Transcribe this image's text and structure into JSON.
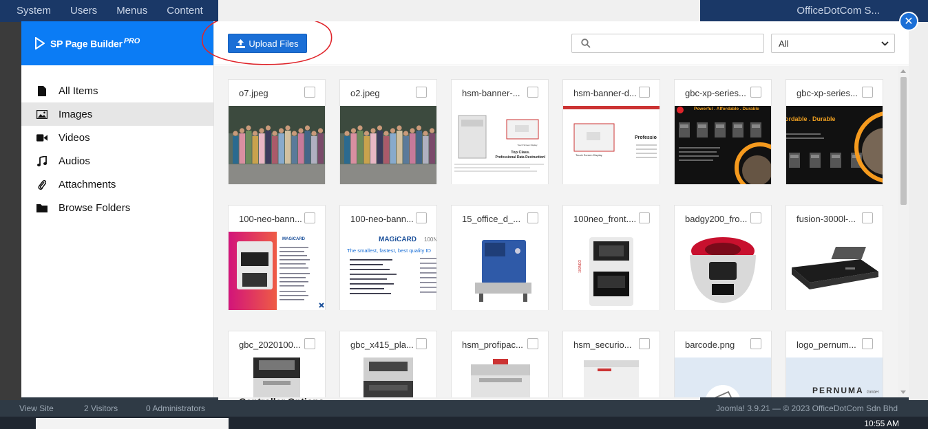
{
  "background": {
    "menu": [
      "System",
      "Users",
      "Menus",
      "Content"
    ],
    "site_name": "OfficeDotCom S...",
    "status_items": [
      "View Site",
      "2 Visitors",
      "0 Administrators"
    ],
    "footer": "Joomla! 3.9.21 — © 2023 OfficeDotCom Sdn Bhd",
    "controller_options": "Controller Options",
    "clock": "10:55 AM"
  },
  "sidebar": {
    "brand": "SP Page Builder",
    "brand_suffix": "PRO",
    "items": [
      {
        "label": "All Items",
        "icon": "file-icon",
        "active": false
      },
      {
        "label": "Images",
        "icon": "image-icon",
        "active": true
      },
      {
        "label": "Videos",
        "icon": "video-icon",
        "active": false
      },
      {
        "label": "Audios",
        "icon": "music-icon",
        "active": false
      },
      {
        "label": "Attachments",
        "icon": "paperclip-icon",
        "active": false
      },
      {
        "label": "Browse Folders",
        "icon": "folder-icon",
        "active": false
      }
    ]
  },
  "toolbar": {
    "upload_label": "Upload Files",
    "search_placeholder": "",
    "filter_value": "All"
  },
  "files": [
    {
      "name": "o7.jpeg",
      "thumb": "group-photo"
    },
    {
      "name": "o2.jpeg",
      "thumb": "group-photo"
    },
    {
      "name": "hsm-banner-...",
      "thumb": "hsm-banner"
    },
    {
      "name": "hsm-banner-d...",
      "thumb": "hsm-banner-2"
    },
    {
      "name": "gbc-xp-series...",
      "thumb": "gbc-dark"
    },
    {
      "name": "gbc-xp-series...",
      "thumb": "gbc-dark-2"
    },
    {
      "name": "100-neo-bann...",
      "thumb": "magicard-pink"
    },
    {
      "name": "100-neo-bann...",
      "thumb": "magicard-white"
    },
    {
      "name": "15_office_d_...",
      "thumb": "blue-machine"
    },
    {
      "name": "100neo_front....",
      "thumb": "card-printer"
    },
    {
      "name": "badgy200_fro...",
      "thumb": "badgy-printer"
    },
    {
      "name": "fusion-3000l-...",
      "thumb": "laminator"
    },
    {
      "name": "gbc_2020100...",
      "thumb": "shredder-gbc"
    },
    {
      "name": "gbc_x415_pla...",
      "thumb": "shredder-gbc-2"
    },
    {
      "name": "hsm_profipac...",
      "thumb": "hsm-profipack"
    },
    {
      "name": "hsm_securio...",
      "thumb": "hsm-securio"
    },
    {
      "name": "barcode.png",
      "thumb": "barcode"
    },
    {
      "name": "logo_pernum...",
      "thumb": "pernuma-logo"
    }
  ],
  "thumb_text": {
    "top_class": "Top Class.",
    "destruction": "Professional Data Destruction!",
    "touch_screen": "Touch Screen Display",
    "powerful": "Powerful . Affordable . Durable",
    "affordable": "ordable . Durable",
    "magicard": "MAGiCARD",
    "neo": "100NEO",
    "smallest": "The smallest, fastest, best quality ID",
    "professi": "Professio",
    "pernuma": "PERNUMA",
    "gmbh": "GmbH"
  }
}
